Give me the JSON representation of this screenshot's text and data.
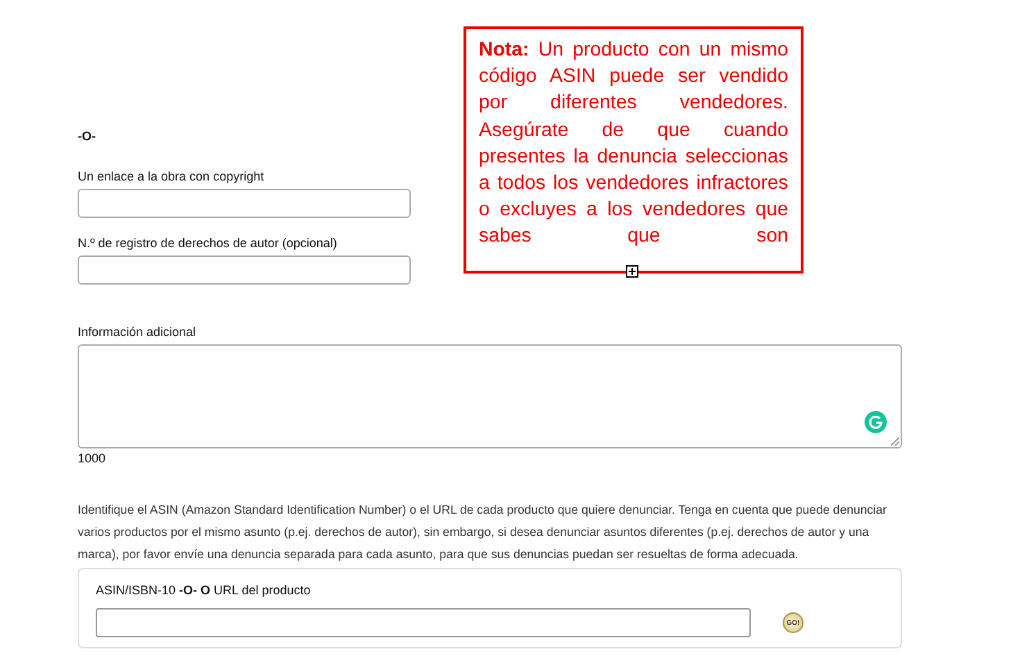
{
  "separator": "-O-",
  "fields": [
    {
      "label": "Un enlace a la obra con copyright"
    },
    {
      "label": "N.º de registro de derechos de autor (opcional)"
    }
  ],
  "additional_info": {
    "label": "Información adicional",
    "counter": "1000"
  },
  "instructions": "Identifique el ASIN (Amazon Standard Identification Number) o el URL de cada producto que quiere denunciar. Tenga en cuenta que puede denunciar varios productos por el mismo asunto (p.ej. derechos de autor), sin embargo, si desea denunciar asuntos diferentes (p.ej. derechos de autor y una marca), por favor envíe una denuncia separada para cada asunto, para que sus denuncias puedan ser resueltas de forma adecuada.",
  "product_box": {
    "label": "ASIN/ISBN-10  **-O-  O** URL del producto",
    "button": "GO!"
  },
  "note": "**Nota:** Un producto con un mismo código ASIN puede ser vendido por diferentes vendedores. Asegúrate de que cuando presentes la denuncia seleccionas a todos los vendedores infractores o excluyes a los vendedores que sabes que son"
}
